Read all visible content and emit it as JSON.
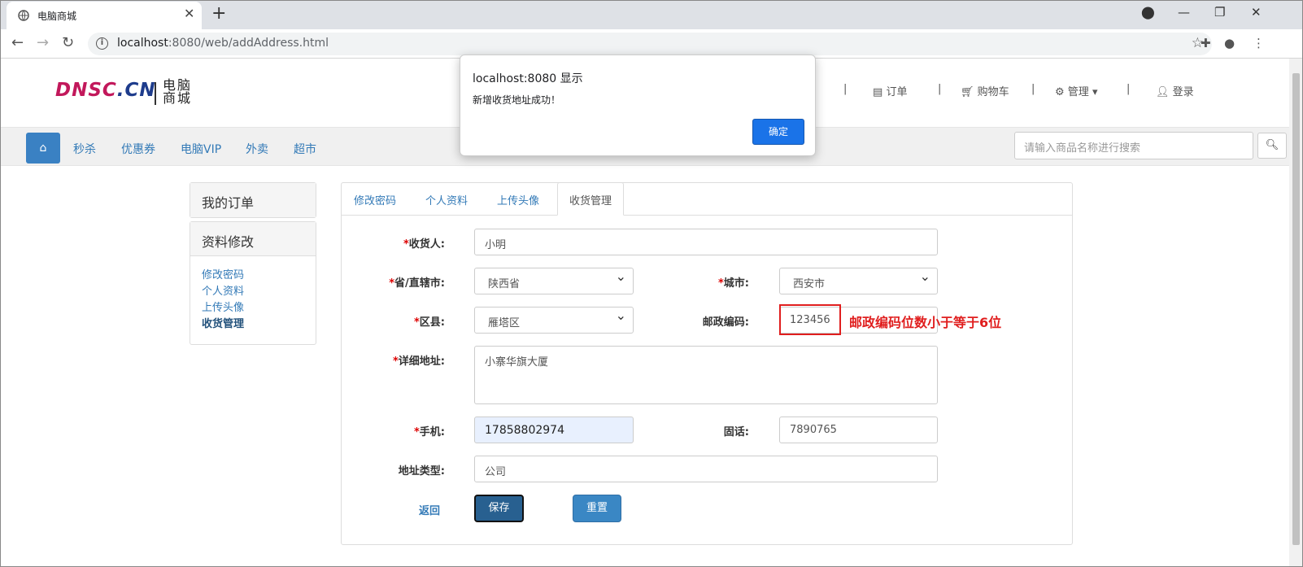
{
  "browser": {
    "tab_title": "电脑商城",
    "new_tab": "+",
    "close_tab": "✕",
    "url_host": "localhost",
    "url_rest": ":8080/web/addAddress.html"
  },
  "header": {
    "logo_en_first": "DNSC",
    "logo_en_rest": ".CN",
    "logo_cn": "电脑商城",
    "links": {
      "orders": "订单",
      "cart": "购物车",
      "manage": "管理",
      "login": "登录"
    }
  },
  "navbar": {
    "items": [
      "秒杀",
      "优惠券",
      "电脑VIP",
      "外卖",
      "超市"
    ],
    "search_placeholder": "请输入商品名称进行搜索"
  },
  "sidebar": {
    "my_orders": "我的订单",
    "profile_edit": "资料修改",
    "links": [
      "修改密码",
      "个人资料",
      "上传头像",
      "收货管理"
    ],
    "active_index": 3
  },
  "tabs": [
    "修改密码",
    "个人资料",
    "上传头像",
    "收货管理"
  ],
  "form": {
    "receiver_label": "收货人:",
    "receiver_value": "小明",
    "province_label": "省/直辖市:",
    "province_value": "陕西省",
    "city_label": "城市:",
    "city_value": "西安市",
    "district_label": "区县:",
    "district_value": "雁塔区",
    "zip_label": "邮政编码:",
    "zip_value": "123456",
    "address_label": "详细地址:",
    "address_value": "小寨华旗大厦",
    "phone_label": "手机:",
    "phone_value": "17858802974",
    "tel_label": "固话:",
    "tel_value": "7890765",
    "type_label": "地址类型:",
    "type_value": "公司",
    "required_mark": "*",
    "back": "返回",
    "save": "保存",
    "reset": "重置"
  },
  "annotation": "邮政编码位数小于等于6位",
  "dialog": {
    "title": "localhost:8080 显示",
    "message": "新增收货地址成功！",
    "ok": "确定"
  },
  "colors": {
    "accent": "#337ab7",
    "primary_btn": "#286090",
    "dialog_ok": "#1a73e8",
    "annotation": "#e01e1e"
  }
}
